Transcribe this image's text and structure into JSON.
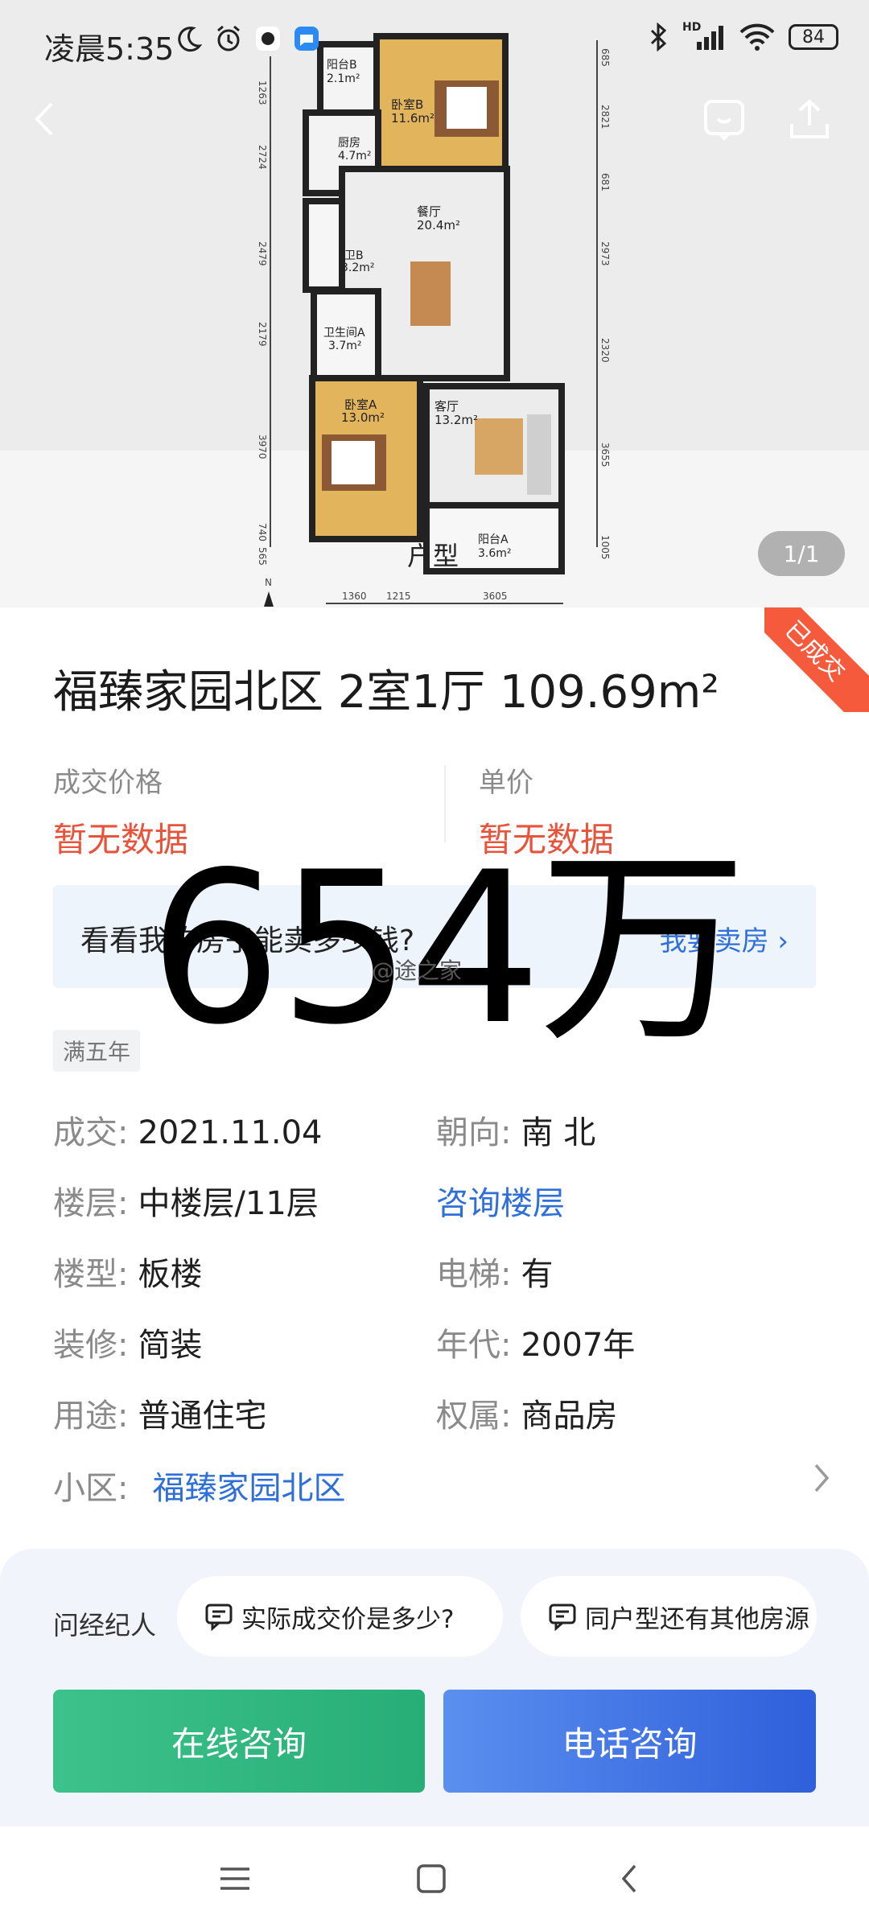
{
  "status_bar": {
    "time": "凌晨5:35",
    "battery": "84",
    "hd_label": "HD"
  },
  "gallery": {
    "counter": "1/1",
    "plan_label": "户型",
    "rooms": [
      {
        "name": "阳台B",
        "area": "2.1m²"
      },
      {
        "name": "卧室B",
        "area": "11.6m²"
      },
      {
        "name": "厨房",
        "area": "4.7m²"
      },
      {
        "name": "餐厅",
        "area": "20.4m²"
      },
      {
        "name": "卫B",
        "area": "3.2m²"
      },
      {
        "name": "卫生间A",
        "area": "3.7m²"
      },
      {
        "name": "卧室A",
        "area": "13.0m²"
      },
      {
        "name": "客厅",
        "area": "13.2m²"
      },
      {
        "name": "阳台A",
        "area": "3.6m²"
      }
    ],
    "dims_left": [
      "1263",
      "2724",
      "2479",
      "2179",
      "3970",
      "740",
      "565"
    ],
    "dims_right": [
      "685",
      "2821",
      "681",
      "2973",
      "2320",
      "3655",
      "1005"
    ],
    "dims_bottom": [
      "1360",
      "1215",
      "3605"
    ],
    "north": "N"
  },
  "listing": {
    "title": "福臻家园北区 2室1厅 109.69m²",
    "ribbon": "已成交",
    "deal_price_label": "成交价格",
    "deal_price_value": "暂无数据",
    "unit_price_label": "单价",
    "unit_price_value": "暂无数据",
    "sell_banner_text": "看看我的房子能卖多少钱?",
    "sell_banner_link": "我要卖房",
    "overlay_price": "654万",
    "watermark": "@途之家",
    "tag": "满五年",
    "details": [
      {
        "key": "成交:",
        "value": "2021.11.04"
      },
      {
        "key": "朝向:",
        "value": "南 北"
      },
      {
        "key": "楼层:",
        "value": "中楼层/11层"
      },
      {
        "key": "",
        "value": "咨询楼层"
      },
      {
        "key": "楼型:",
        "value": "板楼"
      },
      {
        "key": "电梯:",
        "value": "有"
      },
      {
        "key": "装修:",
        "value": "简装"
      },
      {
        "key": "年代:",
        "value": "2007年"
      },
      {
        "key": "用途:",
        "value": "普通住宅"
      },
      {
        "key": "权属:",
        "value": "商品房"
      }
    ],
    "community_label": "小区:",
    "community_value": "福臻家园北区"
  },
  "actions": {
    "ask_label": "问经纪人",
    "chips": [
      "实际成交价是多少?",
      "同户型还有其他房源"
    ],
    "online_btn": "在线咨询",
    "phone_btn": "电话咨询"
  },
  "colors": {
    "accent_red": "#e8543b",
    "link_blue": "#2f6fd8",
    "green": "#27ad76",
    "blue": "#2f5fdb"
  }
}
